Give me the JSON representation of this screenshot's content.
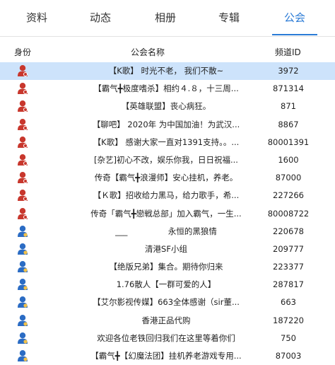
{
  "tabs": [
    {
      "label": "资料"
    },
    {
      "label": "动态"
    },
    {
      "label": "相册"
    },
    {
      "label": "专辑"
    },
    {
      "label": "公会"
    }
  ],
  "colors": {
    "accent": "#2b7bd6",
    "selected_row": "#cde3fb",
    "leader_icon": "#c8372d",
    "member_icon": "#2b6cc4"
  },
  "table": {
    "headers": {
      "role": "身份",
      "name": "公会名称",
      "channel": "频道ID"
    },
    "rows": [
      {
        "role_icon": "leader-icon",
        "name": "【K歌】 时光不老， 我们不散~",
        "channel": "3972"
      },
      {
        "role_icon": "leader-icon",
        "name": "【霸气╋极度嗜杀】相约４.８，十三周...",
        "channel": "871314"
      },
      {
        "role_icon": "leader-icon",
        "name": "【英雄联盟】丧心病狂。",
        "channel": "871"
      },
      {
        "role_icon": "leader-icon",
        "name": "【聊吧】 2020年 为中国加油！为武汉...",
        "channel": "8867"
      },
      {
        "role_icon": "leader-icon",
        "name": "【K歌】 感谢大家一直对1391支持。。...",
        "channel": "80001391"
      },
      {
        "role_icon": "leader-icon",
        "name": "[杂艺]初心不改，娱乐你我，日日祝福...",
        "channel": "1600"
      },
      {
        "role_icon": "leader-icon",
        "name": "传奇【霸气╋浪漫师】安心挂机，养老。",
        "channel": "87000"
      },
      {
        "role_icon": "leader-icon",
        "name": "【Ｋ歌】招收给力黑马，给力歌手，希...",
        "channel": "227266"
      },
      {
        "role_icon": "leader-icon",
        "name": "传奇「霸气╋戀戦总部」加入霸气，一生...",
        "channel": "80008722"
      },
      {
        "role_icon": "member-icon",
        "name": "___　　　　　永恒的黑狼情",
        "channel": "220678"
      },
      {
        "role_icon": "member-icon",
        "name": "清港SF小组",
        "channel": "209777"
      },
      {
        "role_icon": "member-icon",
        "name": "【绝版兄弟】集合。期待你归来",
        "channel": "223377"
      },
      {
        "role_icon": "member-icon",
        "name": "1.76散人【一群可爱的人】",
        "channel": "287817"
      },
      {
        "role_icon": "member-icon",
        "name": "【艾尔影视传媒】663全体感谢（sir董...",
        "channel": "663"
      },
      {
        "role_icon": "member-icon",
        "name": "香港正品代购",
        "channel": "187220"
      },
      {
        "role_icon": "member-icon",
        "name": "欢迎各位老铁回归我们在这里等着你们",
        "channel": "750"
      },
      {
        "role_icon": "member-icon",
        "name": "【霸气╋【幻魔法团】挂机养老游戏专用...",
        "channel": "87003"
      }
    ]
  }
}
